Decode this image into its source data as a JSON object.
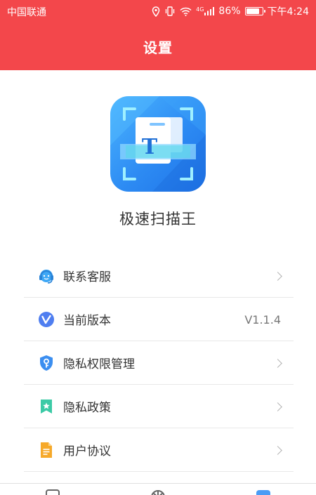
{
  "status_bar": {
    "carrier": "中国联通",
    "network": "4G",
    "battery": "86%",
    "battery_level": 0.86,
    "time": "下午4:24"
  },
  "header": {
    "title": "设置"
  },
  "app": {
    "name": "极速扫描王",
    "logo_letter": "T"
  },
  "menu": [
    {
      "label": "联系客服",
      "icon": "headset-icon",
      "right": ""
    },
    {
      "label": "当前版本",
      "icon": "version-icon",
      "right": "V1.1.4"
    },
    {
      "label": "隐私权限管理",
      "icon": "shield-key-icon",
      "right": ""
    },
    {
      "label": "隐私政策",
      "icon": "bookmark-star-icon",
      "right": ""
    },
    {
      "label": "用户协议",
      "icon": "document-icon",
      "right": ""
    }
  ],
  "colors": {
    "header": "#f3474b",
    "logo_blue": "#2d8bf3"
  }
}
